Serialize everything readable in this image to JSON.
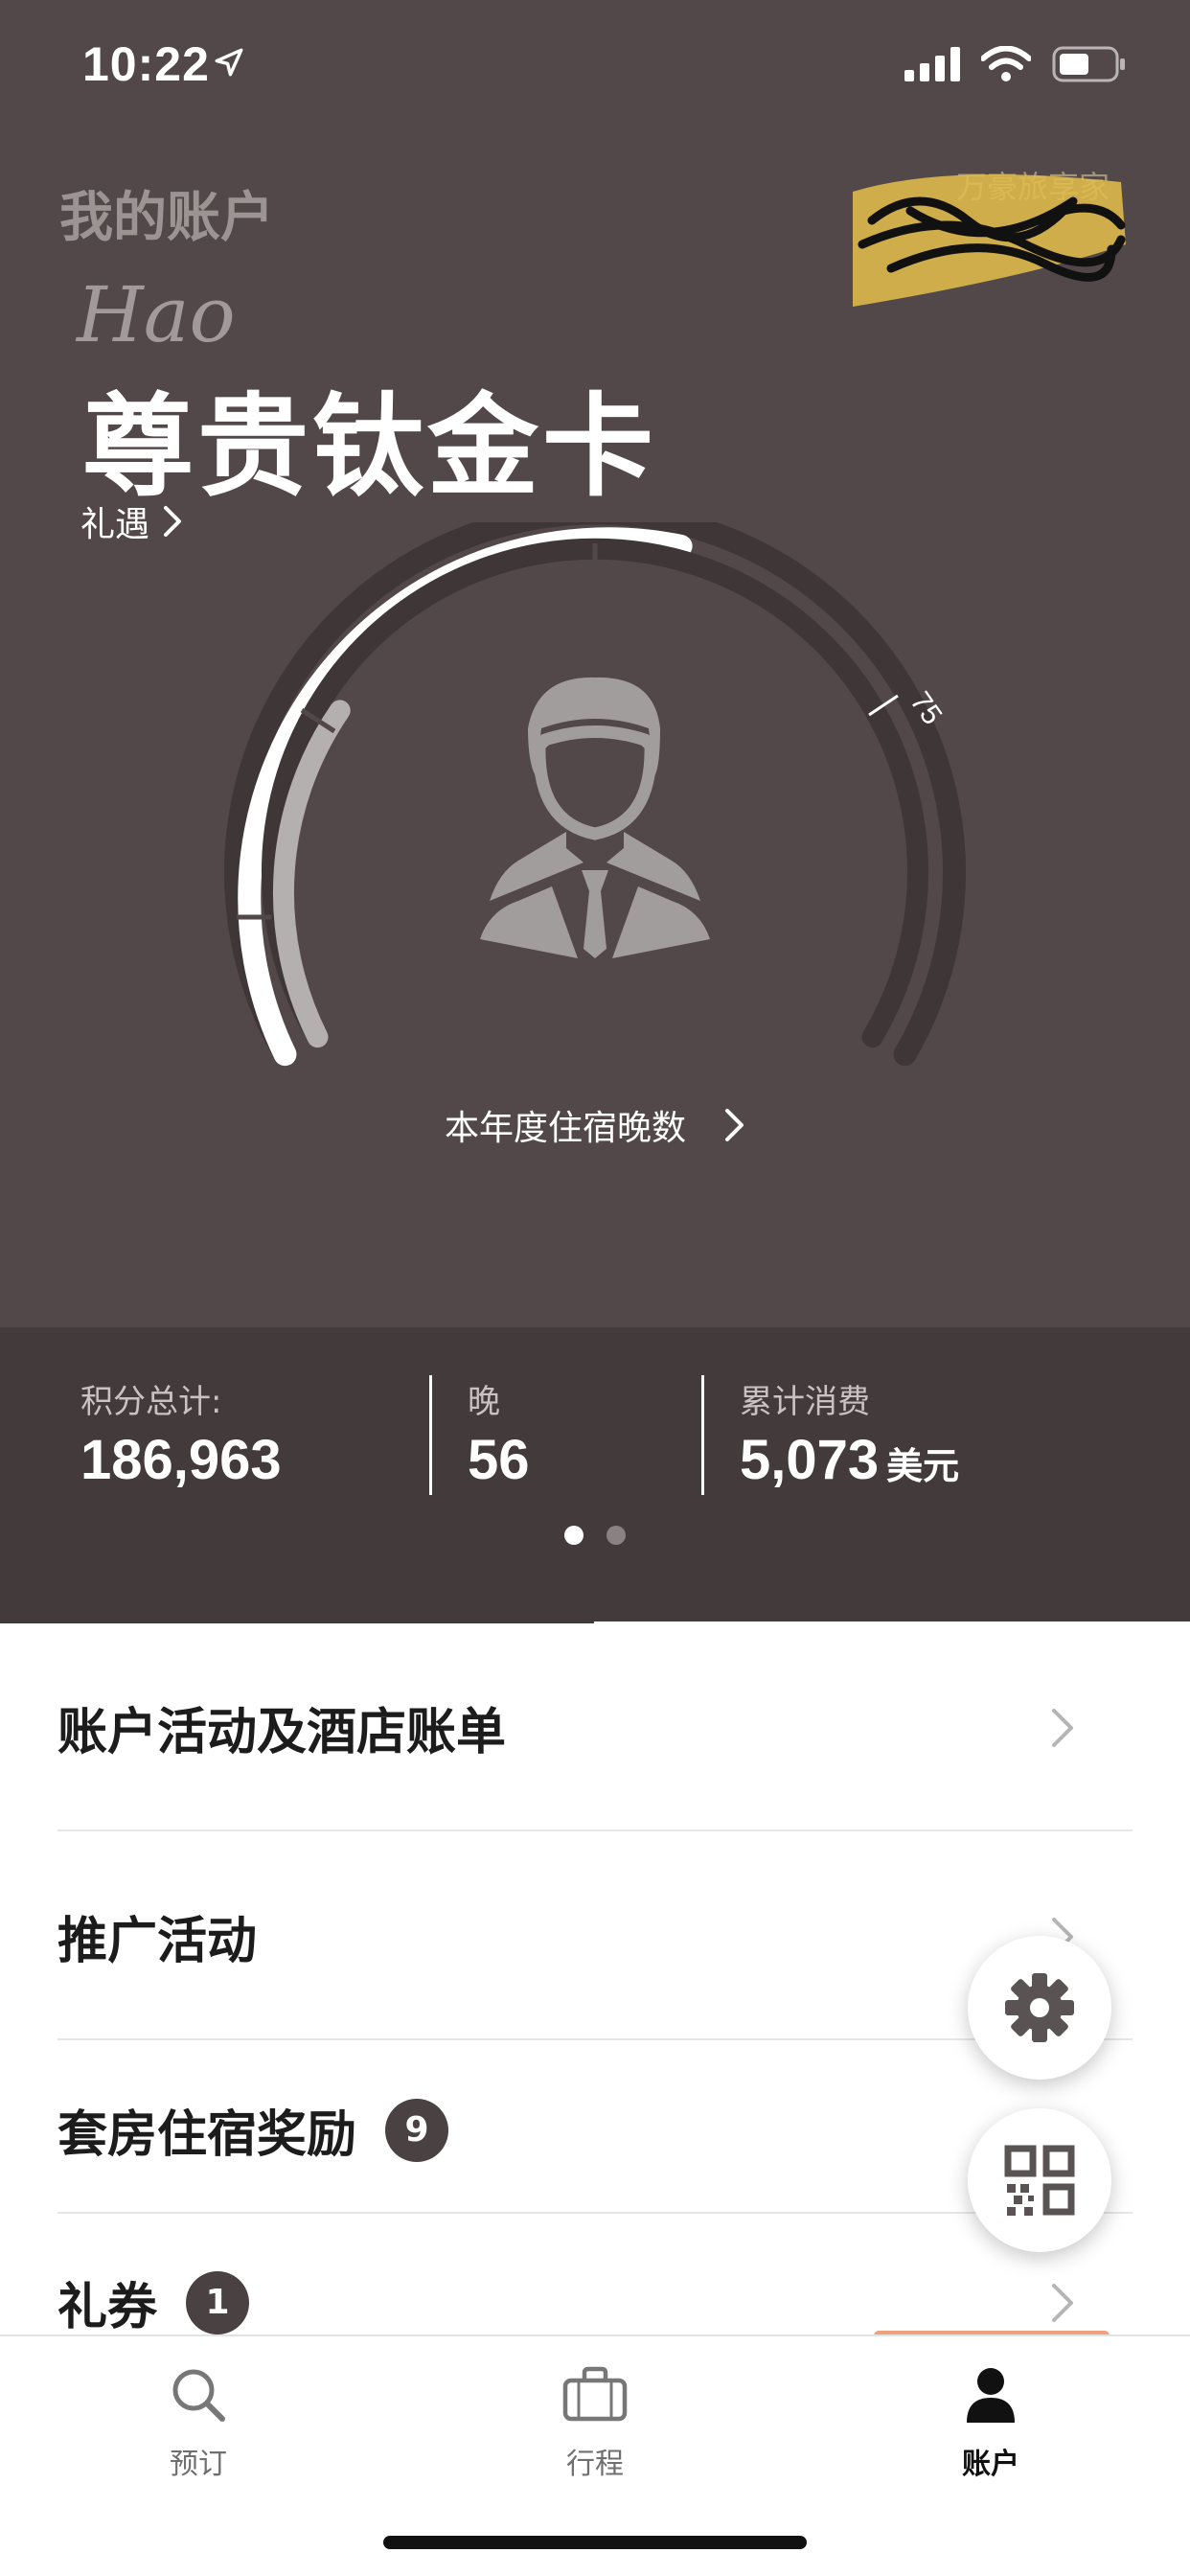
{
  "status_bar": {
    "time": "10:22"
  },
  "header": {
    "title": "我的账户",
    "member_name": "Hao",
    "tier": "尊贵钛金卡",
    "benefits_link": "礼遇",
    "redacted_label": "万豪旅享家"
  },
  "gauge": {
    "milestone_label": "75",
    "nights_link": "本年度住宿晚数",
    "nights_value": 56,
    "max_value": 75
  },
  "stats": [
    {
      "label": "积分总计:",
      "value": "186,963",
      "unit": ""
    },
    {
      "label": "晚",
      "value": "56",
      "unit": ""
    },
    {
      "label": "累计消费",
      "value": "5,073",
      "unit": "美元"
    }
  ],
  "pager": {
    "count": 2,
    "active": 0
  },
  "menu": [
    {
      "label": "账户活动及酒店账单",
      "badge": ""
    },
    {
      "label": "推广活动",
      "badge": ""
    },
    {
      "label": "套房住宿奖励",
      "badge": "9"
    },
    {
      "label": "礼券",
      "badge": "1"
    }
  ],
  "fabs": [
    {
      "icon": "gear-icon"
    },
    {
      "icon": "qr-code-icon"
    }
  ],
  "tabs": [
    {
      "label": "预订",
      "icon": "search-icon",
      "active": false
    },
    {
      "label": "行程",
      "icon": "briefcase-icon",
      "active": false
    },
    {
      "label": "账户",
      "icon": "person-icon",
      "active": true
    }
  ],
  "colors": {
    "hero_bg": "#524849",
    "stats_bg": "#433a3b",
    "badge_bg": "#4a4142",
    "active_tab_accent": "#f0a07e"
  }
}
